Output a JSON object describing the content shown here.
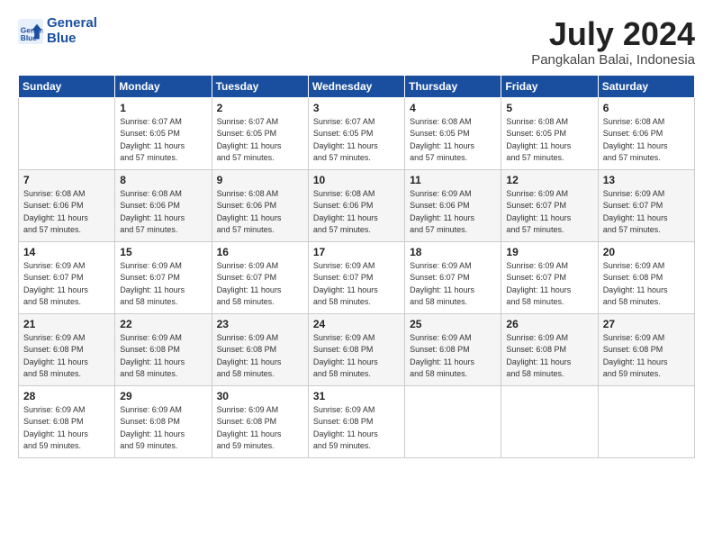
{
  "header": {
    "logo_line1": "General",
    "logo_line2": "Blue",
    "month_title": "July 2024",
    "location": "Pangkalan Balai, Indonesia"
  },
  "days_of_week": [
    "Sunday",
    "Monday",
    "Tuesday",
    "Wednesday",
    "Thursday",
    "Friday",
    "Saturday"
  ],
  "weeks": [
    [
      {
        "day": "",
        "sunrise": "",
        "sunset": "",
        "daylight": ""
      },
      {
        "day": "1",
        "sunrise": "Sunrise: 6:07 AM",
        "sunset": "Sunset: 6:05 PM",
        "daylight": "Daylight: 11 hours and 57 minutes."
      },
      {
        "day": "2",
        "sunrise": "Sunrise: 6:07 AM",
        "sunset": "Sunset: 6:05 PM",
        "daylight": "Daylight: 11 hours and 57 minutes."
      },
      {
        "day": "3",
        "sunrise": "Sunrise: 6:07 AM",
        "sunset": "Sunset: 6:05 PM",
        "daylight": "Daylight: 11 hours and 57 minutes."
      },
      {
        "day": "4",
        "sunrise": "Sunrise: 6:08 AM",
        "sunset": "Sunset: 6:05 PM",
        "daylight": "Daylight: 11 hours and 57 minutes."
      },
      {
        "day": "5",
        "sunrise": "Sunrise: 6:08 AM",
        "sunset": "Sunset: 6:05 PM",
        "daylight": "Daylight: 11 hours and 57 minutes."
      },
      {
        "day": "6",
        "sunrise": "Sunrise: 6:08 AM",
        "sunset": "Sunset: 6:06 PM",
        "daylight": "Daylight: 11 hours and 57 minutes."
      }
    ],
    [
      {
        "day": "7",
        "sunrise": "Sunrise: 6:08 AM",
        "sunset": "Sunset: 6:06 PM",
        "daylight": "Daylight: 11 hours and 57 minutes."
      },
      {
        "day": "8",
        "sunrise": "Sunrise: 6:08 AM",
        "sunset": "Sunset: 6:06 PM",
        "daylight": "Daylight: 11 hours and 57 minutes."
      },
      {
        "day": "9",
        "sunrise": "Sunrise: 6:08 AM",
        "sunset": "Sunset: 6:06 PM",
        "daylight": "Daylight: 11 hours and 57 minutes."
      },
      {
        "day": "10",
        "sunrise": "Sunrise: 6:08 AM",
        "sunset": "Sunset: 6:06 PM",
        "daylight": "Daylight: 11 hours and 57 minutes."
      },
      {
        "day": "11",
        "sunrise": "Sunrise: 6:09 AM",
        "sunset": "Sunset: 6:06 PM",
        "daylight": "Daylight: 11 hours and 57 minutes."
      },
      {
        "day": "12",
        "sunrise": "Sunrise: 6:09 AM",
        "sunset": "Sunset: 6:07 PM",
        "daylight": "Daylight: 11 hours and 57 minutes."
      },
      {
        "day": "13",
        "sunrise": "Sunrise: 6:09 AM",
        "sunset": "Sunset: 6:07 PM",
        "daylight": "Daylight: 11 hours and 57 minutes."
      }
    ],
    [
      {
        "day": "14",
        "sunrise": "Sunrise: 6:09 AM",
        "sunset": "Sunset: 6:07 PM",
        "daylight": "Daylight: 11 hours and 58 minutes."
      },
      {
        "day": "15",
        "sunrise": "Sunrise: 6:09 AM",
        "sunset": "Sunset: 6:07 PM",
        "daylight": "Daylight: 11 hours and 58 minutes."
      },
      {
        "day": "16",
        "sunrise": "Sunrise: 6:09 AM",
        "sunset": "Sunset: 6:07 PM",
        "daylight": "Daylight: 11 hours and 58 minutes."
      },
      {
        "day": "17",
        "sunrise": "Sunrise: 6:09 AM",
        "sunset": "Sunset: 6:07 PM",
        "daylight": "Daylight: 11 hours and 58 minutes."
      },
      {
        "day": "18",
        "sunrise": "Sunrise: 6:09 AM",
        "sunset": "Sunset: 6:07 PM",
        "daylight": "Daylight: 11 hours and 58 minutes."
      },
      {
        "day": "19",
        "sunrise": "Sunrise: 6:09 AM",
        "sunset": "Sunset: 6:07 PM",
        "daylight": "Daylight: 11 hours and 58 minutes."
      },
      {
        "day": "20",
        "sunrise": "Sunrise: 6:09 AM",
        "sunset": "Sunset: 6:08 PM",
        "daylight": "Daylight: 11 hours and 58 minutes."
      }
    ],
    [
      {
        "day": "21",
        "sunrise": "Sunrise: 6:09 AM",
        "sunset": "Sunset: 6:08 PM",
        "daylight": "Daylight: 11 hours and 58 minutes."
      },
      {
        "day": "22",
        "sunrise": "Sunrise: 6:09 AM",
        "sunset": "Sunset: 6:08 PM",
        "daylight": "Daylight: 11 hours and 58 minutes."
      },
      {
        "day": "23",
        "sunrise": "Sunrise: 6:09 AM",
        "sunset": "Sunset: 6:08 PM",
        "daylight": "Daylight: 11 hours and 58 minutes."
      },
      {
        "day": "24",
        "sunrise": "Sunrise: 6:09 AM",
        "sunset": "Sunset: 6:08 PM",
        "daylight": "Daylight: 11 hours and 58 minutes."
      },
      {
        "day": "25",
        "sunrise": "Sunrise: 6:09 AM",
        "sunset": "Sunset: 6:08 PM",
        "daylight": "Daylight: 11 hours and 58 minutes."
      },
      {
        "day": "26",
        "sunrise": "Sunrise: 6:09 AM",
        "sunset": "Sunset: 6:08 PM",
        "daylight": "Daylight: 11 hours and 58 minutes."
      },
      {
        "day": "27",
        "sunrise": "Sunrise: 6:09 AM",
        "sunset": "Sunset: 6:08 PM",
        "daylight": "Daylight: 11 hours and 59 minutes."
      }
    ],
    [
      {
        "day": "28",
        "sunrise": "Sunrise: 6:09 AM",
        "sunset": "Sunset: 6:08 PM",
        "daylight": "Daylight: 11 hours and 59 minutes."
      },
      {
        "day": "29",
        "sunrise": "Sunrise: 6:09 AM",
        "sunset": "Sunset: 6:08 PM",
        "daylight": "Daylight: 11 hours and 59 minutes."
      },
      {
        "day": "30",
        "sunrise": "Sunrise: 6:09 AM",
        "sunset": "Sunset: 6:08 PM",
        "daylight": "Daylight: 11 hours and 59 minutes."
      },
      {
        "day": "31",
        "sunrise": "Sunrise: 6:09 AM",
        "sunset": "Sunset: 6:08 PM",
        "daylight": "Daylight: 11 hours and 59 minutes."
      },
      {
        "day": "",
        "sunrise": "",
        "sunset": "",
        "daylight": ""
      },
      {
        "day": "",
        "sunrise": "",
        "sunset": "",
        "daylight": ""
      },
      {
        "day": "",
        "sunrise": "",
        "sunset": "",
        "daylight": ""
      }
    ]
  ]
}
